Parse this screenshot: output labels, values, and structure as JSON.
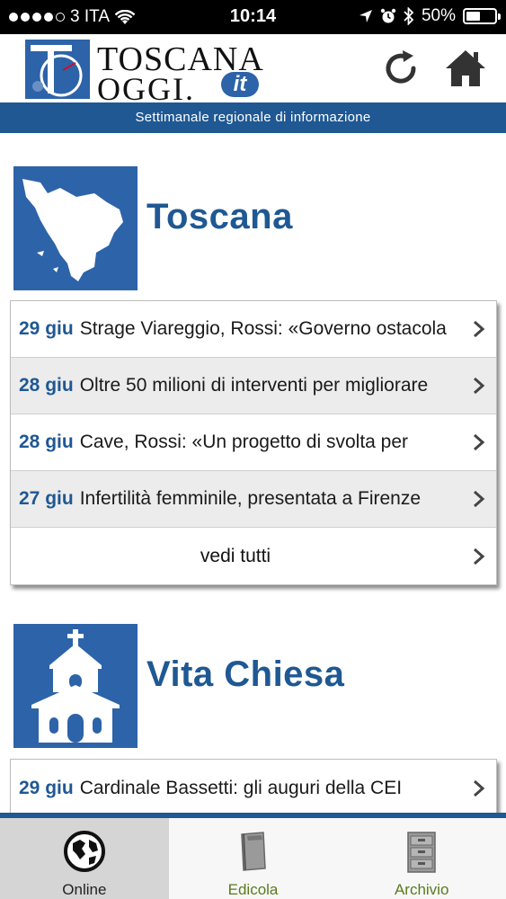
{
  "status": {
    "carrier": "3 ITA",
    "time": "10:14",
    "battery": "50%",
    "battery_level": 0.5
  },
  "header": {
    "logo_line1": "TOSCANA",
    "logo_line2": "OGGI.",
    "logo_suffix": "it",
    "logo_monogram": "TO",
    "refresh_icon": "refresh-icon",
    "home_icon": "home-icon"
  },
  "banner": {
    "text": "Settimanale regionale di informazione"
  },
  "sections": [
    {
      "title": "Toscana",
      "icon": "tuscany-map-icon",
      "items": [
        {
          "date": "29 giu",
          "title": "Strage Viareggio, Rossi: «Governo ostacola"
        },
        {
          "date": "28 giu",
          "title": "Oltre 50 milioni di interventi per migliorare"
        },
        {
          "date": "28 giu",
          "title": "Cave, Rossi: «Un progetto di svolta per"
        },
        {
          "date": "27 giu",
          "title": "Infertilità femminile, presentata a Firenze"
        }
      ],
      "see_all": "vedi tutti"
    },
    {
      "title": "Vita Chiesa",
      "icon": "church-icon",
      "items": [
        {
          "date": "29 giu",
          "title": "Cardinale Bassetti: gli auguri della CEI"
        }
      ]
    }
  ],
  "tabs": [
    {
      "label": "Online",
      "icon": "globe-icon",
      "active": true
    },
    {
      "label": "Edicola",
      "icon": "newspaper-icon",
      "active": false
    },
    {
      "label": "Archivio",
      "icon": "archive-cabinet-icon",
      "active": false
    }
  ],
  "colors": {
    "brand_blue": "#1f5893",
    "tile_blue": "#2d63a8",
    "tab_green": "#5a7a1e"
  }
}
